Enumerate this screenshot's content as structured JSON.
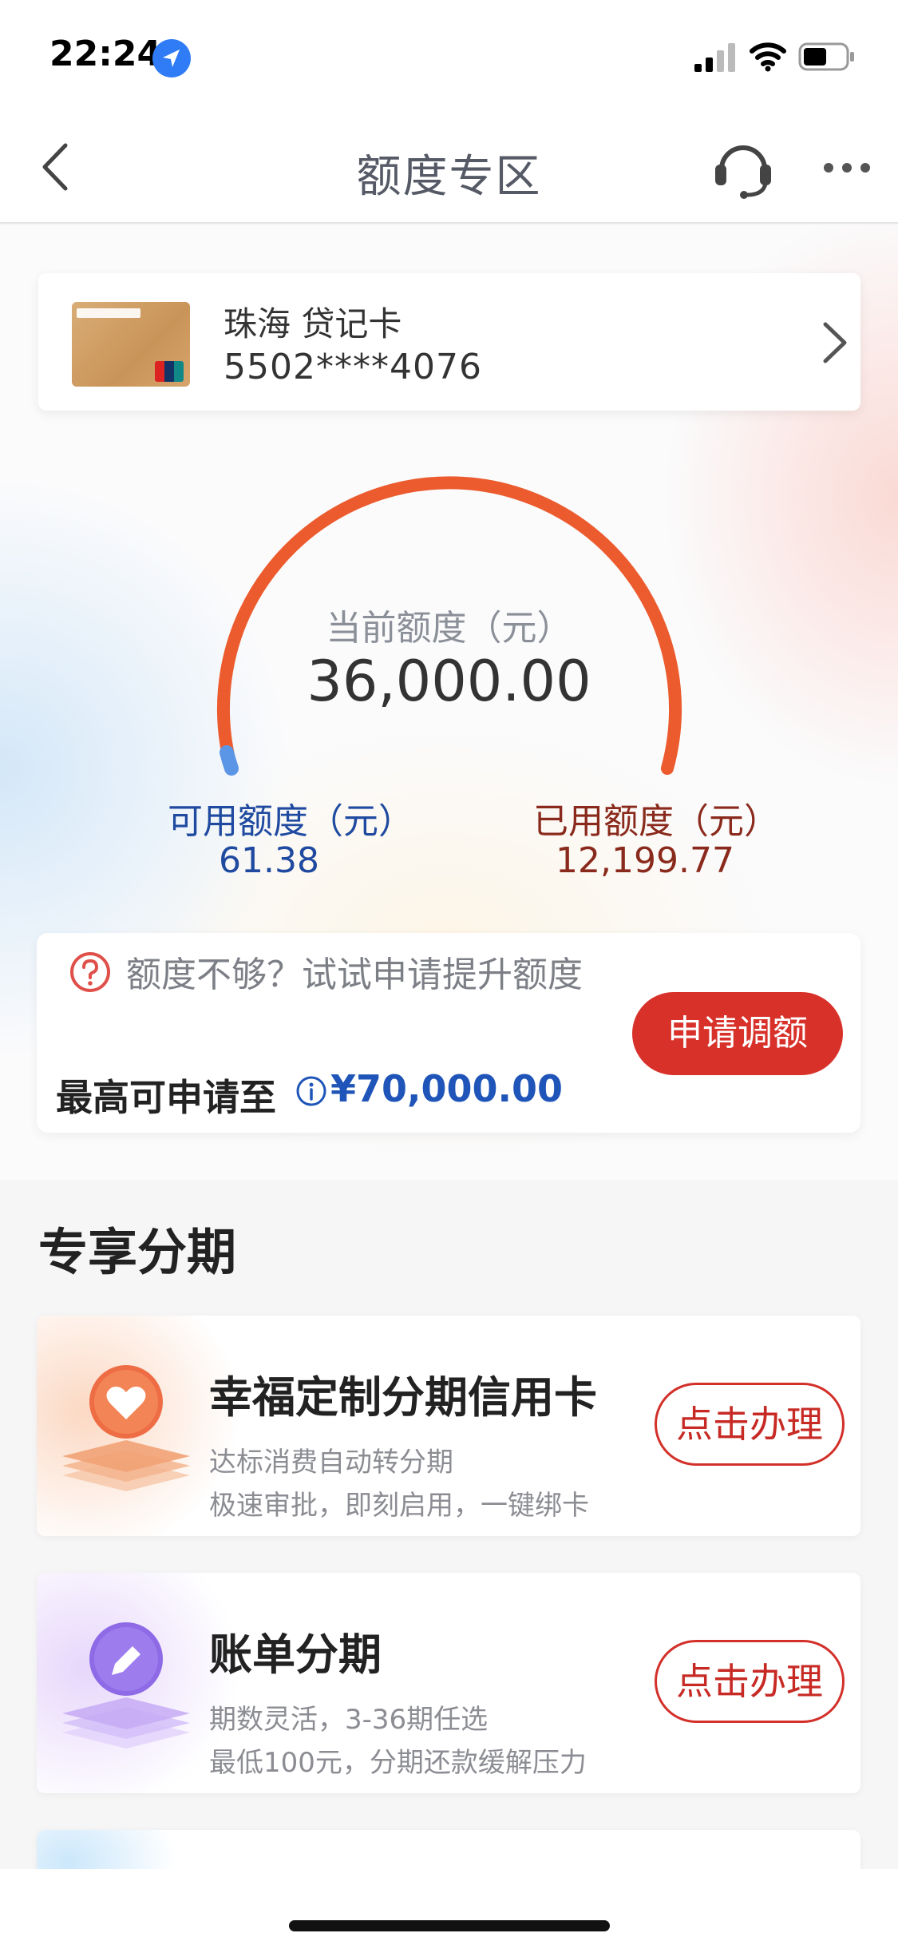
{
  "status_bar": {
    "time": "22:24"
  },
  "nav": {
    "title": "额度专区"
  },
  "card": {
    "name": "珠海 贷记卡",
    "number": "5502****4076"
  },
  "credit": {
    "current_label": "当前额度（元）",
    "current_value": "36,000.00",
    "available_label": "可用额度（元）",
    "available_value": "61.38",
    "used_label": "已用额度（元）",
    "used_value": "12,199.77",
    "gauge_color": "#ec5b2e",
    "gauge_start_color": "#5b96e6"
  },
  "promo": {
    "title": "额度不够？试试申请提升额度",
    "max_label": "最高可申请至",
    "max_value": "¥70,000.00",
    "button_label": "申请调额"
  },
  "section": {
    "title": "专享分期",
    "products": [
      {
        "title": "幸福定制分期信用卡",
        "desc1": "达标消费自动转分期",
        "desc2": "极速审批，即刻启用，一键绑卡",
        "button": "点击办理",
        "icon": "heart-icon"
      },
      {
        "title": "账单分期",
        "desc1": "期数灵活，3-36期任选",
        "desc2": "最低100元，分期还款缓解压力",
        "button": "点击办理",
        "icon": "pencil-icon"
      }
    ]
  },
  "colors": {
    "accent_red": "#d8312a",
    "link_blue": "#1f55b8"
  }
}
